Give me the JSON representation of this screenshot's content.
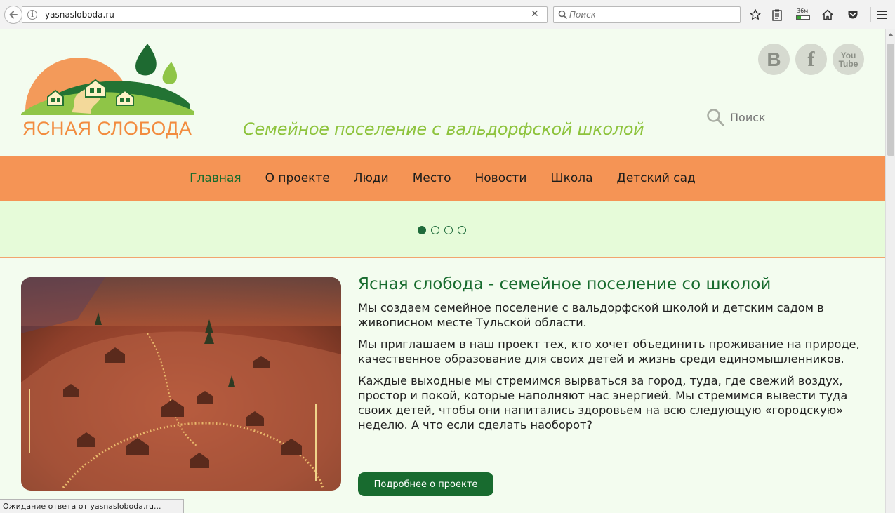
{
  "browser": {
    "url": "yasnasloboda.ru",
    "search_placeholder": "Поиск",
    "memory_label": "36м",
    "memory_fraction": 0.35
  },
  "icons": {
    "back": "back-arrow-icon",
    "info": "info-icon",
    "close": "close-icon",
    "search": "search-icon",
    "bookmark": "star-icon",
    "reading_list": "clipboard-icon",
    "home": "home-icon",
    "pocket": "pocket-icon",
    "menu": "hamburger-menu-icon"
  },
  "header": {
    "logo_text": "ЯСНАЯ СЛОБОДА",
    "tagline": "Семейное поселение с вальдорфской школой",
    "social": {
      "vk": "B",
      "fb": "f",
      "yt_top": "You",
      "yt_bottom": "Tube"
    },
    "search_placeholder": "Поиск"
  },
  "nav": {
    "items": [
      {
        "label": "Главная",
        "active": true
      },
      {
        "label": "О проекте",
        "active": false
      },
      {
        "label": "Люди",
        "active": false
      },
      {
        "label": "Место",
        "active": false
      },
      {
        "label": "Новости",
        "active": false
      },
      {
        "label": "Школа",
        "active": false
      },
      {
        "label": "Детский сад",
        "active": false
      }
    ]
  },
  "slider": {
    "total": 4,
    "active": 1
  },
  "content": {
    "title": "Ясная слобода - семейное поселение со школой",
    "p1": "Мы создаем семейное поселение с вальдорфской школой и детским садом в живописном месте Тульской области.",
    "p2": "Мы приглашаем в наш проект тех, кто хочет объединить проживание на природе, качественное образование для своих детей и жизнь среди единомышленников.",
    "p3": "Каждые выходные мы стремимся вырваться за город, туда, где свежий воздух, простор и  покой, которые наполняют нас энергией. Мы стремимся вывести туда своих детей, чтобы они напитались здоровьем на всю следующую «городскую» неделю.  А что если сделать наоборот?",
    "more_button": "Подробнее о проекте"
  },
  "status": {
    "text": "Ожидание ответа от yasnasloboda.ru..."
  },
  "colors": {
    "nav_bg": "#f59455",
    "slider_bg": "#e6fbd9",
    "accent_green": "#176b2e",
    "tagline_green": "#8dc33c",
    "logo_orange": "#f28c3f"
  }
}
